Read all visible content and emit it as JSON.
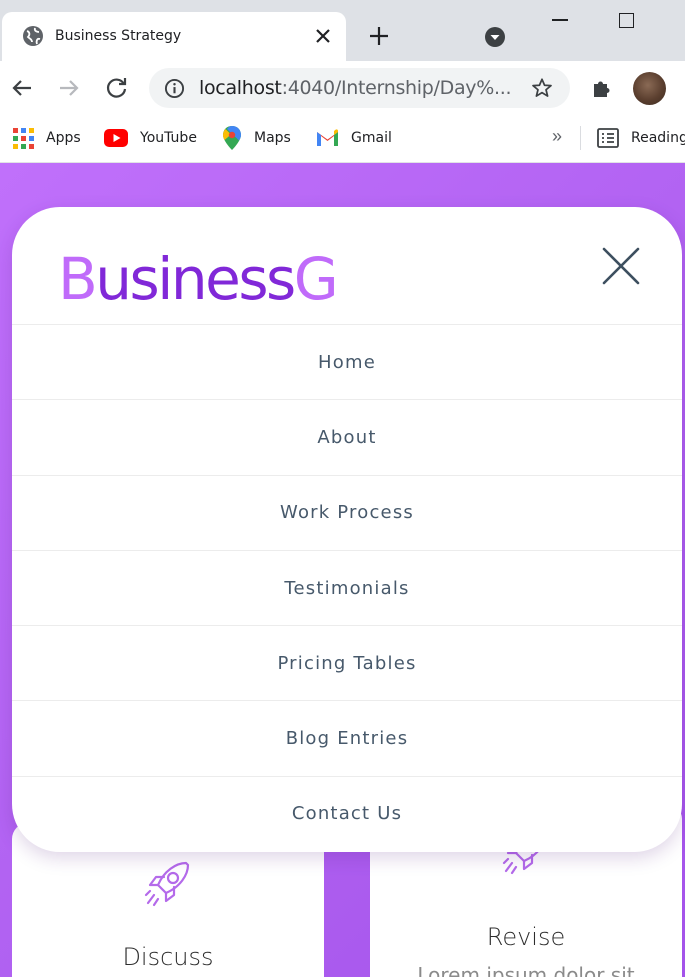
{
  "browser": {
    "tab": {
      "title": "Business Strategy",
      "favicon": "globe-icon"
    },
    "address_bar": {
      "host": "localhost",
      "path": ":4040/Internship/Day%..."
    },
    "bookmarks": [
      {
        "label": "Apps",
        "icon": "apps-grid-icon"
      },
      {
        "label": "YouTube",
        "icon": "youtube-icon"
      },
      {
        "label": "Maps",
        "icon": "maps-pin-icon"
      },
      {
        "label": "Gmail",
        "icon": "gmail-icon"
      }
    ],
    "bookmarks_more": "»",
    "reading_list": "Reading"
  },
  "site": {
    "logo": {
      "accent_1": "B",
      "text_1": "usiness",
      "accent_2": "G"
    },
    "menu": [
      "Home",
      "About",
      "Work Process",
      "Testimonials",
      "Pricing Tables",
      "Blog Entries",
      "Contact Us"
    ],
    "cards": [
      {
        "title": "Discuss",
        "icon": "rocket-icon"
      },
      {
        "title": "Revise",
        "icon": "rocket-icon",
        "text": "Lorem ipsum dolor sit"
      }
    ],
    "colors": {
      "logo_primary": "#8128d8",
      "logo_accent": "#c06bfa",
      "background": "#b061f1",
      "menu_text": "#47596b"
    }
  }
}
